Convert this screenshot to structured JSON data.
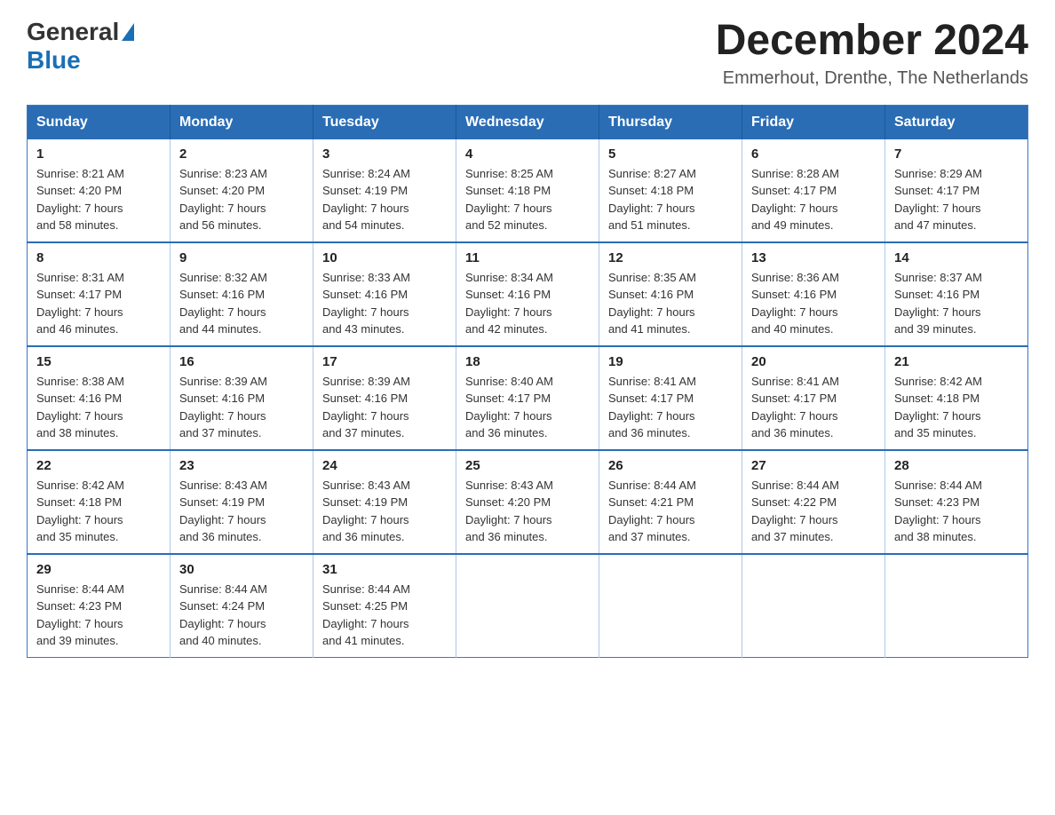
{
  "header": {
    "logo_general": "General",
    "logo_blue": "Blue",
    "month_year": "December 2024",
    "location": "Emmerhout, Drenthe, The Netherlands"
  },
  "weekdays": [
    "Sunday",
    "Monday",
    "Tuesday",
    "Wednesday",
    "Thursday",
    "Friday",
    "Saturday"
  ],
  "weeks": [
    [
      {
        "day": "1",
        "sunrise": "8:21 AM",
        "sunset": "4:20 PM",
        "daylight": "7 hours and 58 minutes."
      },
      {
        "day": "2",
        "sunrise": "8:23 AM",
        "sunset": "4:20 PM",
        "daylight": "7 hours and 56 minutes."
      },
      {
        "day": "3",
        "sunrise": "8:24 AM",
        "sunset": "4:19 PM",
        "daylight": "7 hours and 54 minutes."
      },
      {
        "day": "4",
        "sunrise": "8:25 AM",
        "sunset": "4:18 PM",
        "daylight": "7 hours and 52 minutes."
      },
      {
        "day": "5",
        "sunrise": "8:27 AM",
        "sunset": "4:18 PM",
        "daylight": "7 hours and 51 minutes."
      },
      {
        "day": "6",
        "sunrise": "8:28 AM",
        "sunset": "4:17 PM",
        "daylight": "7 hours and 49 minutes."
      },
      {
        "day": "7",
        "sunrise": "8:29 AM",
        "sunset": "4:17 PM",
        "daylight": "7 hours and 47 minutes."
      }
    ],
    [
      {
        "day": "8",
        "sunrise": "8:31 AM",
        "sunset": "4:17 PM",
        "daylight": "7 hours and 46 minutes."
      },
      {
        "day": "9",
        "sunrise": "8:32 AM",
        "sunset": "4:16 PM",
        "daylight": "7 hours and 44 minutes."
      },
      {
        "day": "10",
        "sunrise": "8:33 AM",
        "sunset": "4:16 PM",
        "daylight": "7 hours and 43 minutes."
      },
      {
        "day": "11",
        "sunrise": "8:34 AM",
        "sunset": "4:16 PM",
        "daylight": "7 hours and 42 minutes."
      },
      {
        "day": "12",
        "sunrise": "8:35 AM",
        "sunset": "4:16 PM",
        "daylight": "7 hours and 41 minutes."
      },
      {
        "day": "13",
        "sunrise": "8:36 AM",
        "sunset": "4:16 PM",
        "daylight": "7 hours and 40 minutes."
      },
      {
        "day": "14",
        "sunrise": "8:37 AM",
        "sunset": "4:16 PM",
        "daylight": "7 hours and 39 minutes."
      }
    ],
    [
      {
        "day": "15",
        "sunrise": "8:38 AM",
        "sunset": "4:16 PM",
        "daylight": "7 hours and 38 minutes."
      },
      {
        "day": "16",
        "sunrise": "8:39 AM",
        "sunset": "4:16 PM",
        "daylight": "7 hours and 37 minutes."
      },
      {
        "day": "17",
        "sunrise": "8:39 AM",
        "sunset": "4:16 PM",
        "daylight": "7 hours and 37 minutes."
      },
      {
        "day": "18",
        "sunrise": "8:40 AM",
        "sunset": "4:17 PM",
        "daylight": "7 hours and 36 minutes."
      },
      {
        "day": "19",
        "sunrise": "8:41 AM",
        "sunset": "4:17 PM",
        "daylight": "7 hours and 36 minutes."
      },
      {
        "day": "20",
        "sunrise": "8:41 AM",
        "sunset": "4:17 PM",
        "daylight": "7 hours and 36 minutes."
      },
      {
        "day": "21",
        "sunrise": "8:42 AM",
        "sunset": "4:18 PM",
        "daylight": "7 hours and 35 minutes."
      }
    ],
    [
      {
        "day": "22",
        "sunrise": "8:42 AM",
        "sunset": "4:18 PM",
        "daylight": "7 hours and 35 minutes."
      },
      {
        "day": "23",
        "sunrise": "8:43 AM",
        "sunset": "4:19 PM",
        "daylight": "7 hours and 36 minutes."
      },
      {
        "day": "24",
        "sunrise": "8:43 AM",
        "sunset": "4:19 PM",
        "daylight": "7 hours and 36 minutes."
      },
      {
        "day": "25",
        "sunrise": "8:43 AM",
        "sunset": "4:20 PM",
        "daylight": "7 hours and 36 minutes."
      },
      {
        "day": "26",
        "sunrise": "8:44 AM",
        "sunset": "4:21 PM",
        "daylight": "7 hours and 37 minutes."
      },
      {
        "day": "27",
        "sunrise": "8:44 AM",
        "sunset": "4:22 PM",
        "daylight": "7 hours and 37 minutes."
      },
      {
        "day": "28",
        "sunrise": "8:44 AM",
        "sunset": "4:23 PM",
        "daylight": "7 hours and 38 minutes."
      }
    ],
    [
      {
        "day": "29",
        "sunrise": "8:44 AM",
        "sunset": "4:23 PM",
        "daylight": "7 hours and 39 minutes."
      },
      {
        "day": "30",
        "sunrise": "8:44 AM",
        "sunset": "4:24 PM",
        "daylight": "7 hours and 40 minutes."
      },
      {
        "day": "31",
        "sunrise": "8:44 AM",
        "sunset": "4:25 PM",
        "daylight": "7 hours and 41 minutes."
      },
      null,
      null,
      null,
      null
    ]
  ],
  "labels": {
    "sunrise": "Sunrise:",
    "sunset": "Sunset:",
    "daylight": "Daylight:"
  }
}
